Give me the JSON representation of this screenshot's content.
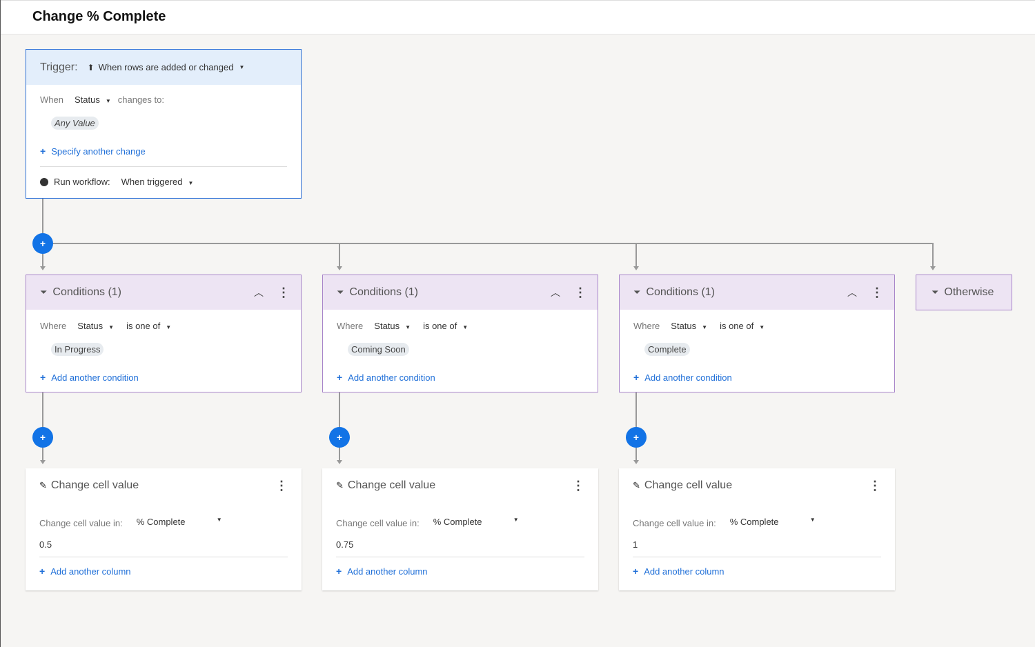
{
  "header": {
    "title": "Change % Complete"
  },
  "trigger": {
    "label": "Trigger:",
    "type": "When rows are added or changed",
    "when": "When",
    "field": "Status",
    "changes_to": "changes to:",
    "value": "Any Value",
    "specify_link": "Specify another change",
    "run_label": "Run workflow:",
    "run_value": "When triggered"
  },
  "branches": [
    {
      "title": "Conditions (1)",
      "where": "Where",
      "field": "Status",
      "operator": "is one of",
      "value": "In Progress",
      "add_condition": "Add another condition",
      "action": {
        "title": "Change cell value",
        "in_label": "Change cell value in:",
        "column": "% Complete",
        "value": "0.5",
        "add_column": "Add another column"
      }
    },
    {
      "title": "Conditions (1)",
      "where": "Where",
      "field": "Status",
      "operator": "is one of",
      "value": "Coming Soon",
      "add_condition": "Add another condition",
      "action": {
        "title": "Change cell value",
        "in_label": "Change cell value in:",
        "column": "% Complete",
        "value": "0.75",
        "add_column": "Add another column"
      }
    },
    {
      "title": "Conditions (1)",
      "where": "Where",
      "field": "Status",
      "operator": "is one of",
      "value": "Complete",
      "add_condition": "Add another condition",
      "action": {
        "title": "Change cell value",
        "in_label": "Change cell value in:",
        "column": "% Complete",
        "value": "1",
        "add_column": "Add another column"
      }
    }
  ],
  "otherwise": {
    "label": "Otherwise"
  },
  "colors": {
    "accent": "#1273e6",
    "trigger_border": "#2a6ed6",
    "condition_border": "#a784c9",
    "condition_header": "#ede4f3",
    "trigger_header": "#e3eefb"
  }
}
